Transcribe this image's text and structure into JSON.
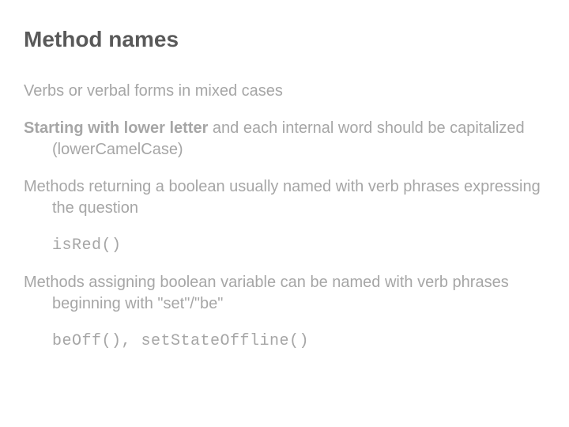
{
  "title": "Method names",
  "p1": "Verbs or verbal forms in mixed cases",
  "p2_strong": "Starting with lower letter",
  "p2_rest": " and each internal word should be capitalized (lowerCamelCase)",
  "p3": "Methods returning a boolean usually named with verb phrases expressing the question",
  "code1": "isRed()",
  "p4": "Methods assigning boolean variable can be named with verb phrases beginning with \"set\"/\"be\"",
  "code2": "beOff(), setStateOffline()"
}
